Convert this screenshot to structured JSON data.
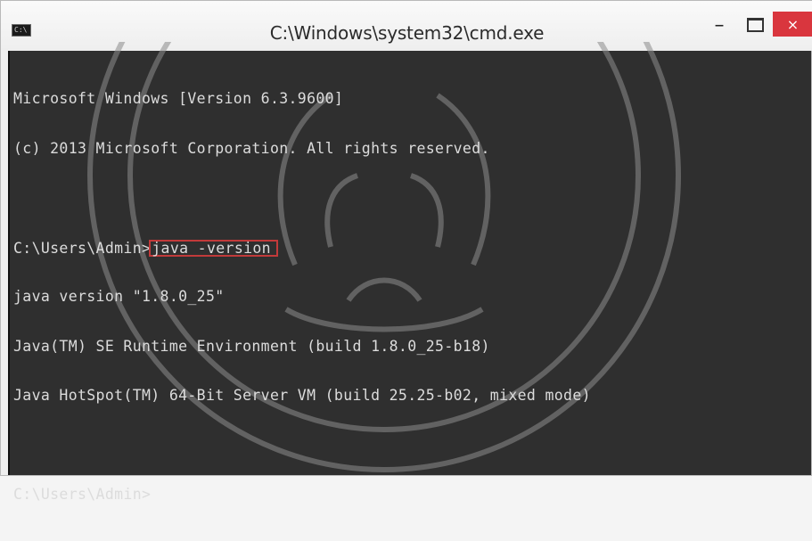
{
  "window": {
    "title": "C:\\Windows\\system32\\cmd.exe",
    "icon_text": "C:\\",
    "controls": {
      "minimize": "–",
      "close": "×"
    }
  },
  "console": {
    "lines": [
      "Microsoft Windows [Version 6.3.9600]",
      "(c) 2013 Microsoft Corporation. All rights reserved.",
      "",
      "java version \"1.8.0_25\"",
      "Java(TM) SE Runtime Environment (build 1.8.0_25-b18)",
      "Java HotSpot(TM) 64-Bit Server VM (build 25.25-b02, mixed mode)",
      "",
      "C:\\Users\\Admin>"
    ],
    "prompt": "C:\\Users\\Admin>",
    "command": "java -version"
  },
  "colors": {
    "console_bg": "#2f2f2f",
    "console_fg": "#dcdcdc",
    "highlight_border": "#c23a3a",
    "close_button": "#d9363e"
  },
  "icons": [
    "cmd-app-icon",
    "minimize-icon",
    "maximize-icon",
    "close-icon"
  ]
}
